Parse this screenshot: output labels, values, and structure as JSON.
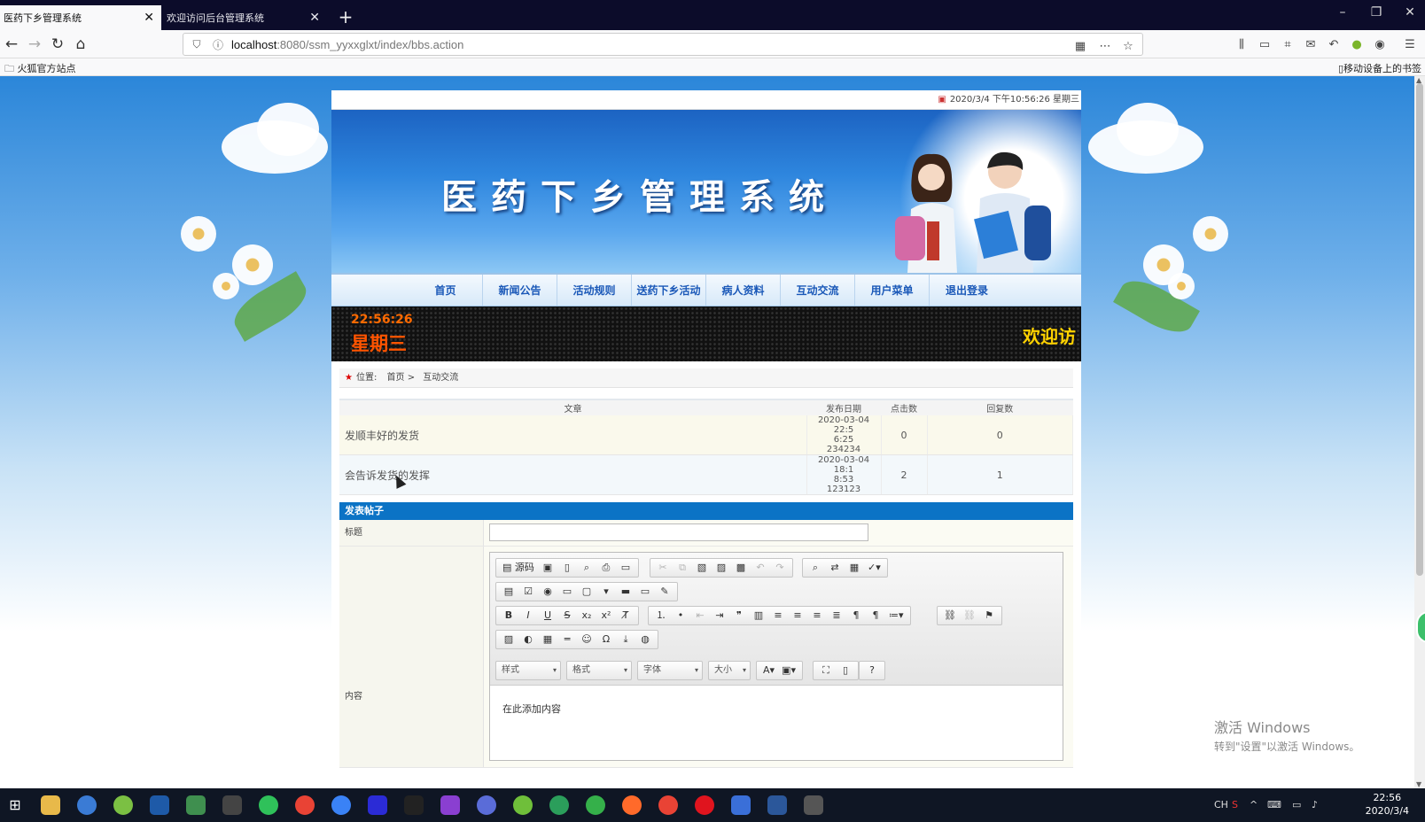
{
  "browser": {
    "tabs": [
      {
        "label": "医药下乡管理系统",
        "active": true
      },
      {
        "label": "欢迎访问后台管理系统",
        "active": false
      }
    ],
    "url_host": "localhost",
    "url_rest": ":8080/ssm_yyxxglxt/index/bbs.action",
    "bookmarks_left": "火狐官方站点",
    "bookmarks_right": "移动设备上的书签"
  },
  "site": {
    "datetime_top": "2020/3/4 下午10:56:26 星期三",
    "banner_title": "医药下乡管理系统",
    "menu": [
      "首页",
      "新闻公告",
      "活动规则",
      "送药下乡活动",
      "病人资料",
      "互动交流",
      "用户菜单",
      "退出登录"
    ],
    "led": {
      "time": "22:56:26",
      "day": "星期三",
      "scroll": "欢迎访"
    },
    "breadcrumb": {
      "label": "位置:",
      "home": "首页",
      "sep": ">",
      "current": "互动交流"
    }
  },
  "posts": {
    "headers": [
      "文章",
      "发布日期",
      "点击数",
      "回复数"
    ],
    "rows": [
      {
        "title": "发顺丰好的发货",
        "date_a": "2020-03-04 22:5",
        "date_b": "6:25",
        "author": "234234",
        "clicks": "0",
        "replies": "0"
      },
      {
        "title": "会告诉发货的发挥",
        "date_a": "2020-03-04 18:1",
        "date_b": "8:53",
        "author": "123123",
        "clicks": "2",
        "replies": "1"
      }
    ]
  },
  "form": {
    "heading": "发表帖子",
    "title_label": "标题",
    "title_value": "",
    "content_label": "内容",
    "content_value": "在此添加内容",
    "toolbar": {
      "source": "源码",
      "style": "样式",
      "format": "格式",
      "font": "字体",
      "size": "大小"
    }
  },
  "os": {
    "watermark_title": "激活 Windows",
    "watermark_sub": "转到\"设置\"以激活 Windows。",
    "time": "22:56",
    "date": "2020/3/4",
    "ime": "CH"
  },
  "colors": {
    "accent": "#0b73c5",
    "menu_text": "#1a58b8",
    "led_time": "#ff6a00",
    "led_welcome": "#ffd200"
  }
}
